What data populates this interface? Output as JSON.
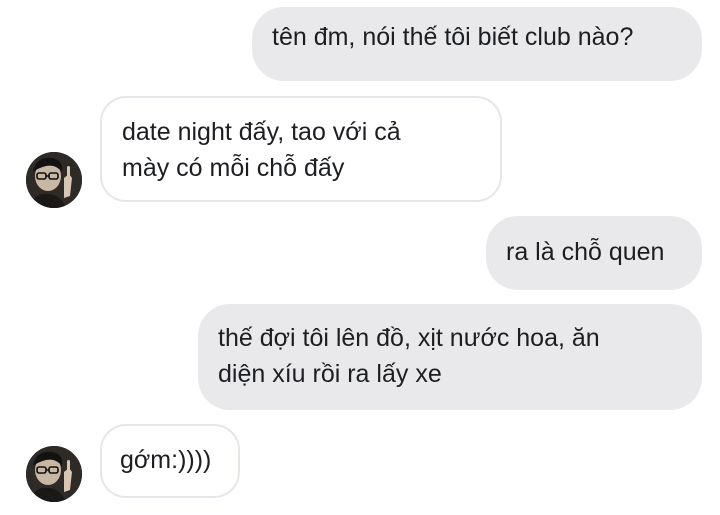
{
  "conversation": {
    "messages": [
      {
        "sender": "me",
        "lines": [
          "tên đm, nói thế tôi biết club nào?"
        ]
      },
      {
        "sender": "them",
        "lines": [
          "date night đấy, tao với cả",
          "mày có mỗi chỗ đấy"
        ]
      },
      {
        "sender": "me",
        "lines": [
          "ra là chỗ quen"
        ]
      },
      {
        "sender": "me",
        "lines": [
          "thế đợi tôi lên đồ, xịt nước hoa, ăn",
          "diện xíu rồi ra lấy xe"
        ]
      },
      {
        "sender": "them",
        "lines": [
          "gớm:))))"
        ]
      }
    ]
  },
  "colors": {
    "outgoing_bubble": "#e9e9eb",
    "incoming_border": "#e4e6eb",
    "text": "#1c1e21"
  },
  "icons": {
    "avatar": "contact-avatar-photo"
  }
}
